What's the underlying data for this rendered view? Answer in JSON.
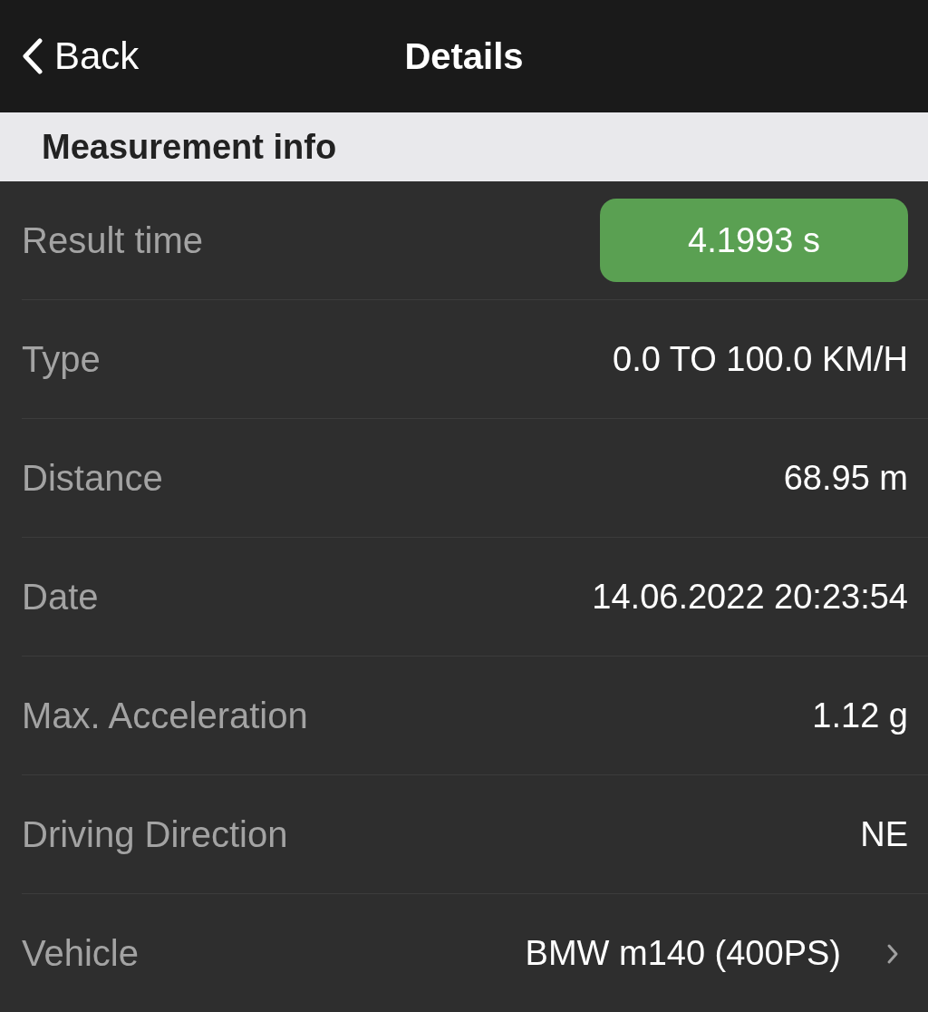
{
  "nav_bar": {
    "back_label": "Back",
    "title": "Details"
  },
  "section": {
    "title": "Measurement info"
  },
  "rows": [
    {
      "kind": "badge",
      "label": "Result time",
      "value": "4.1993 s"
    },
    {
      "kind": "text",
      "label": "Type",
      "value": "0.0 TO 100.0 KM/H"
    },
    {
      "kind": "text",
      "label": "Distance",
      "value": "68.95 m"
    },
    {
      "kind": "text",
      "label": "Date",
      "value": "14.06.2022 20:23:54"
    },
    {
      "kind": "text",
      "label": "Max. Acceleration",
      "value": "1.12 g"
    },
    {
      "kind": "text",
      "label": "Driving Direction",
      "value": "NE"
    },
    {
      "kind": "link",
      "label": "Vehicle",
      "value": "BMW m140 (400PS)"
    }
  ]
}
